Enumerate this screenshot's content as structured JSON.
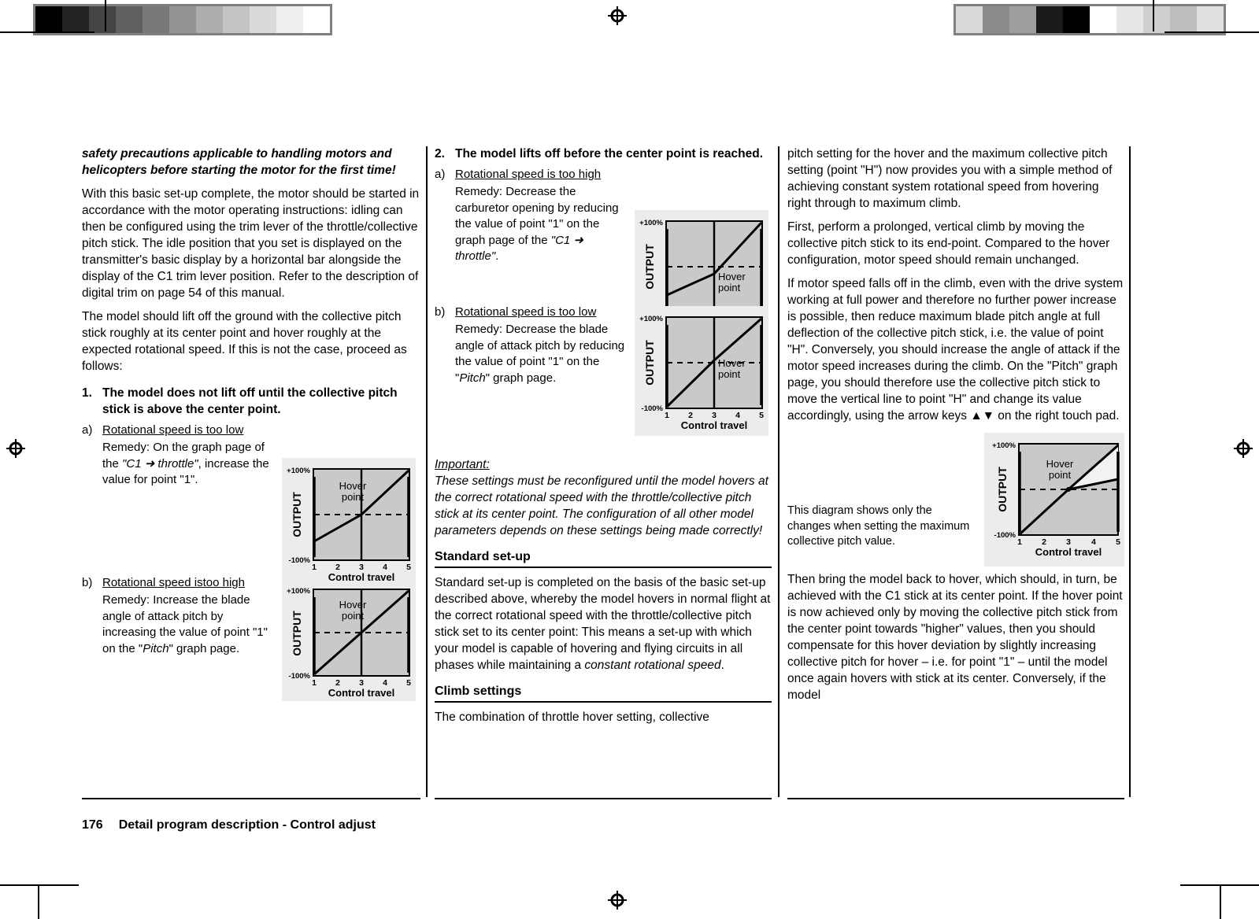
{
  "document": {
    "page_number": "176",
    "footer_title": "Detail program description - Control adjust"
  },
  "calibration": {
    "left_swatches": [
      "#000000",
      "#232323",
      "#444444",
      "#606060",
      "#787878",
      "#949494",
      "#adadad",
      "#c4c4c4",
      "#dadada",
      "#efefef",
      "#ffffff"
    ],
    "right_swatches": [
      "#d9d9d9",
      "#8a8a8a",
      "#9e9e9e",
      "#1a1a1a",
      "#000000",
      "#ffffff",
      "#e6e6e6",
      "#cfcfcf",
      "#bdbdbd",
      "#e0e0e0"
    ]
  },
  "column1": {
    "lead_bold_italic": "safety precautions applicable to handling motors and helicopters before starting the motor for the first time!",
    "para1": "With this basic set-up complete, the motor should be started in accordance with the motor operating instructions: idling can then be configured using the trim lever of the throttle/collective pitch stick. The idle position that you set is displayed on the transmitter's basic display by a horizontal bar alongside the display of the C1 trim lever position. Refer to the description of digital trim on page 54 of this manual.",
    "para2": "The model should lift off the ground with the collective pitch stick roughly at its center point and hover roughly at the expected rotational speed. If this is not the case, proceed as follows:",
    "item1": {
      "number": "1.",
      "title": "The model does not lift off until the collective pitch stick is above the center point.",
      "a": {
        "letter": "a)",
        "heading": "Rotational speed is too low",
        "remedy_pre": "Remedy: On the graph page of the ",
        "remedy_italic": "\"C1 ➜ throttle\"",
        "remedy_post": ", increase the value for point \"1\"."
      },
      "b": {
        "letter": "b)",
        "heading": "Rotational speed istoo high",
        "remedy_pre": "Remedy: Increase the blade angle of attack pitch by increasing the value of point \"1\" on the \"",
        "remedy_italic": "Pitch",
        "remedy_post": "\" graph page."
      }
    }
  },
  "column2": {
    "item2": {
      "number": "2.",
      "title": "The model lifts off before the center point is reached.",
      "a": {
        "letter": "a)",
        "heading": "Rotational speed is too high",
        "remedy_pre": "Remedy: Decrease the carburetor opening by reducing the value of point \"1\" on the graph page of the ",
        "remedy_italic": "\"C1 ➜ throttle\"",
        "remedy_post": "."
      },
      "b": {
        "letter": "b)",
        "heading": "Rotational speed is too low",
        "remedy_pre": "Remedy: Decrease the blade angle of attack pitch by reducing the value of point \"1\" on the \"",
        "remedy_italic": "Pitch",
        "remedy_post": "\" graph page."
      }
    },
    "important": {
      "label": "Important:",
      "text": "These settings must be reconfigured until the model hovers at the correct rotational speed with the throttle/collective pitch stick at its center point. The configuration of all other model parameters depends on these settings being made correctly!"
    },
    "standard_setup": {
      "heading": "Standard set-up",
      "para_pre": "Standard set-up is completed on the basis of the basic set-up described above, whereby the model hovers in normal flight at the correct rotational speed with the throttle/collective pitch stick set to its center point: This means a set-up with which your model is capable of hovering and flying circuits in all phases while maintaining a ",
      "para_italic": "constant rotational speed",
      "para_post": "."
    },
    "climb_settings": {
      "heading": "Climb settings",
      "para": "The combination of throttle hover setting, collective"
    }
  },
  "column3": {
    "para1": "pitch setting for the hover and the maximum collective pitch setting (point \"H\") now provides you with a simple method of achieving constant system rotational speed from hovering right through to maximum climb.",
    "para2": "First, perform a prolonged, vertical climb by moving the collective pitch stick to its end-point. Compared to the hover configuration, motor speed should remain unchanged.",
    "para3": "If motor speed falls off in the climb, even with the drive system working at full power and therefore no further power increase is possible, then reduce maximum blade pitch angle at full deflection of the collective pitch stick, i.e. the value of point \"H\". Conversely, you should increase the angle of attack if the motor speed increases during the climb. On the \"Pitch\" graph page, you should therefore use the collective pitch stick to move the vertical line to point \"H\" and change its value accordingly, using the arrow keys ▲▼ on the right touch pad.",
    "caption": "This diagram shows only the changes when setting the maximum collective pitch value.",
    "para4": "Then bring the model back to hover, which should, in turn, be achieved with the C1 stick at its center point. If the hover point is now achieved only by moving the collective pitch stick from the center point towards \"higher\" values, then you should compensate for this hover deviation by slightly increasing collective pitch for hover – i.e. for point \"1\" – until the model once again hovers with stick at its center. Conversely, if the model"
  },
  "chart_data": [
    {
      "id": "fig-1a",
      "type": "line",
      "title": "",
      "xlabel": "Control travel",
      "ylabel": "OUTPUT",
      "xticks": [
        "1",
        "2",
        "3",
        "4",
        "5"
      ],
      "ytick_top": "+100%",
      "ytick_bottom": "-100%",
      "xlim": [
        1,
        5
      ],
      "ylim": [
        -100,
        100
      ],
      "annotation": "Hover point",
      "hover_point": {
        "x": 3,
        "y": 25
      },
      "grid": false,
      "series": [
        {
          "name": "curve",
          "x": [
            1,
            3,
            5
          ],
          "y": [
            -70,
            25,
            100
          ]
        }
      ]
    },
    {
      "id": "fig-1b",
      "type": "line",
      "title": "",
      "xlabel": "Control travel",
      "ylabel": "OUTPUT",
      "xticks": [
        "1",
        "2",
        "3",
        "4",
        "5"
      ],
      "ytick_top": "+100%",
      "ytick_bottom": "-100%",
      "xlim": [
        1,
        5
      ],
      "ylim": [
        -100,
        100
      ],
      "annotation": "Hover point",
      "hover_point": {
        "x": 3,
        "y": 25
      },
      "grid": false,
      "series": [
        {
          "name": "curve",
          "x": [
            1,
            3,
            5
          ],
          "y": [
            -100,
            25,
            100
          ]
        }
      ]
    },
    {
      "id": "fig-2a",
      "type": "line",
      "title": "",
      "xlabel": "Control travel",
      "ylabel": "OUTPUT",
      "xticks": [
        "1",
        "2",
        "3",
        "4",
        "5"
      ],
      "ytick_top": "+100%",
      "ytick_bottom": "-100%",
      "xlim": [
        1,
        5
      ],
      "ylim": [
        -100,
        100
      ],
      "annotation": "Hover point",
      "hover_point": {
        "x": 3,
        "y": -15
      },
      "grid": false,
      "series": [
        {
          "name": "curve",
          "x": [
            1,
            3,
            5
          ],
          "y": [
            -62,
            -15,
            100
          ]
        }
      ]
    },
    {
      "id": "fig-2b",
      "type": "line",
      "title": "",
      "xlabel": "Control travel",
      "ylabel": "OUTPUT",
      "xticks": [
        "1",
        "2",
        "3",
        "4",
        "5"
      ],
      "ytick_top": "+100%",
      "ytick_bottom": "-100%",
      "xlim": [
        1,
        5
      ],
      "ylim": [
        -100,
        100
      ],
      "annotation": "Hover point",
      "hover_point": {
        "x": 3,
        "y": 5
      },
      "grid": false,
      "series": [
        {
          "name": "curve",
          "x": [
            1,
            3,
            5
          ],
          "y": [
            -100,
            5,
            100
          ]
        }
      ]
    },
    {
      "id": "fig-3",
      "type": "line",
      "title": "",
      "xlabel": "Control travel",
      "ylabel": "OUTPUT",
      "xticks": [
        "1",
        "2",
        "3",
        "4",
        "5"
      ],
      "ytick_top": "+100%",
      "ytick_bottom": "-100%",
      "xlim": [
        1,
        5
      ],
      "ylim": [
        -100,
        100
      ],
      "annotation": "Hover point",
      "hover_point": {
        "x": 3,
        "y": 0
      },
      "grid": false,
      "series": [
        {
          "name": "maximum pitch",
          "x": [
            1,
            3,
            5
          ],
          "y": [
            -100,
            0,
            100
          ]
        },
        {
          "name": "reduced maximum pitch",
          "x": [
            3,
            5
          ],
          "y": [
            0,
            45
          ]
        }
      ]
    }
  ]
}
